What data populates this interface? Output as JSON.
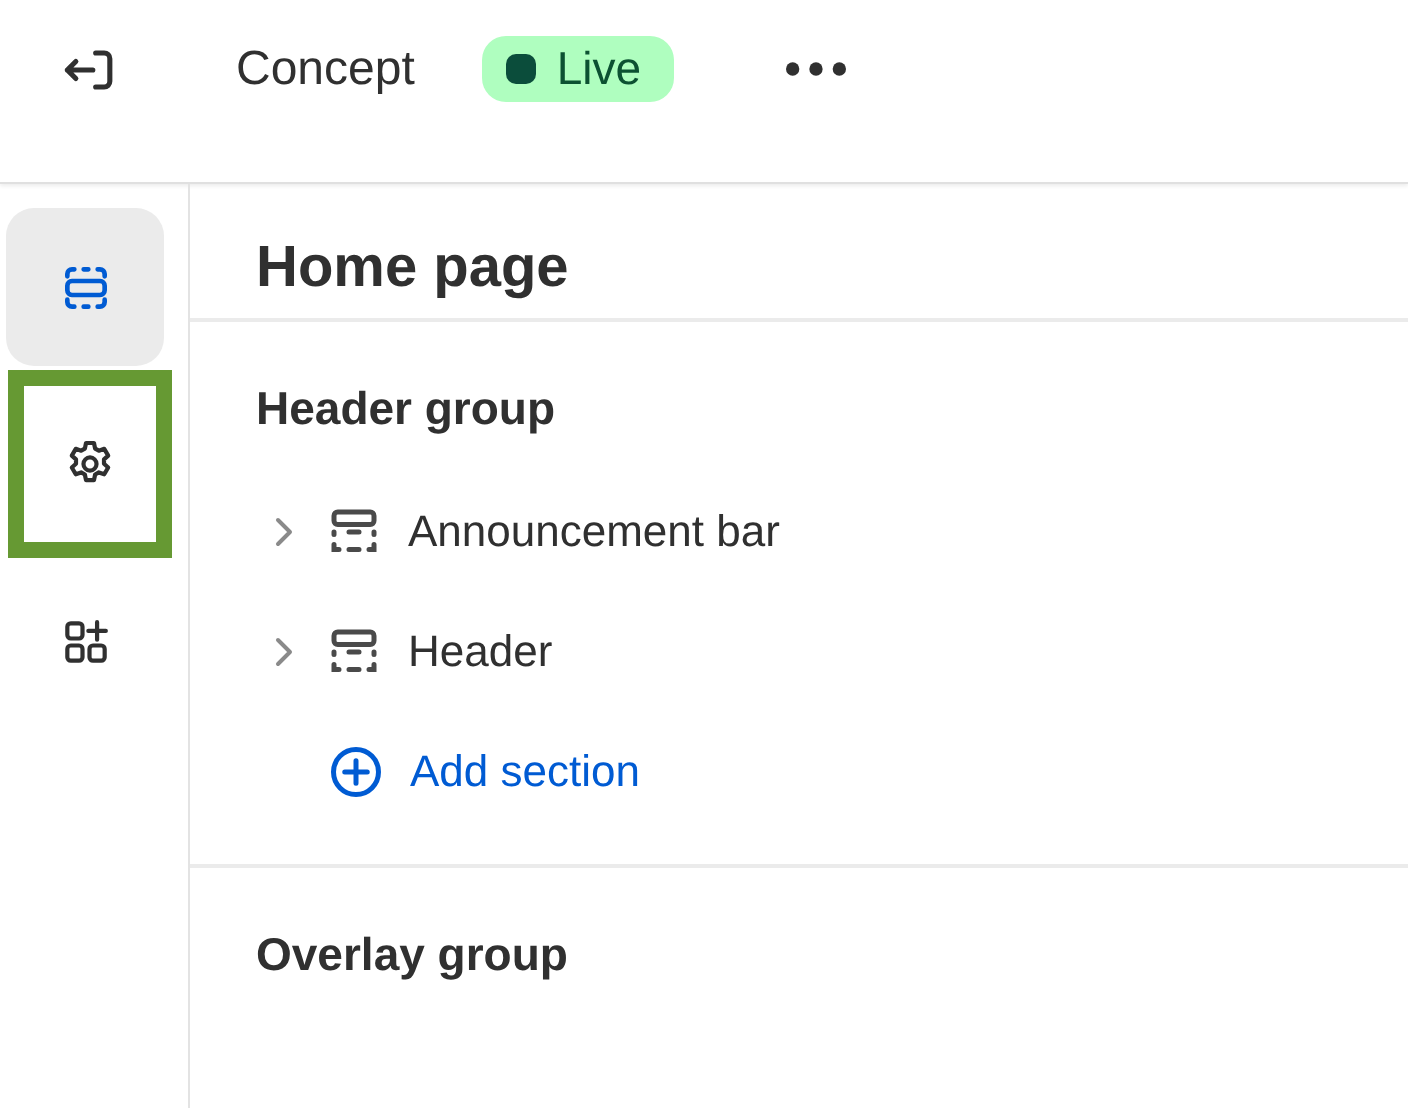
{
  "topbar": {
    "theme_name": "Concept",
    "status": {
      "label": "Live",
      "color": "#0b4d3b"
    }
  },
  "rail": [
    {
      "kind": "sections",
      "selected": true,
      "highlighted": false
    },
    {
      "kind": "settings",
      "selected": false,
      "highlighted": true
    },
    {
      "kind": "apps",
      "selected": false,
      "highlighted": false
    }
  ],
  "panel": {
    "title": "Home page",
    "groups": [
      {
        "title": "Header group",
        "items": [
          {
            "label": "Announcement bar",
            "expanded": false
          },
          {
            "label": "Header",
            "expanded": false
          }
        ],
        "add_label": "Add section"
      },
      {
        "title": "Overlay group"
      }
    ]
  }
}
